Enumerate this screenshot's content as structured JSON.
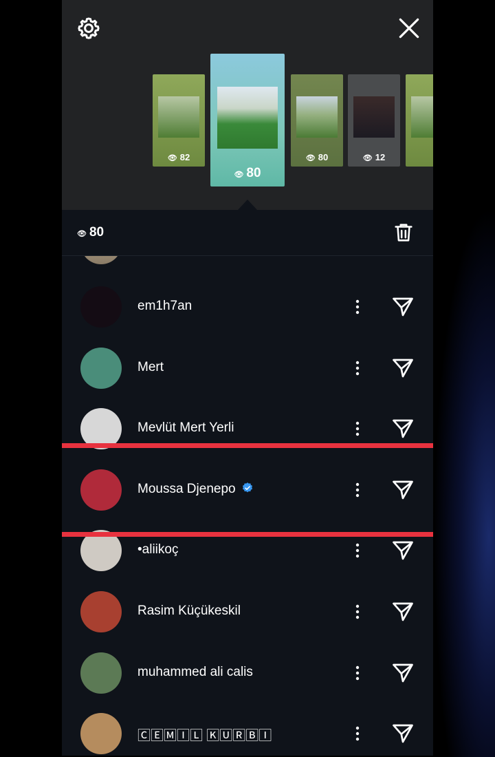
{
  "viewers_count": "80",
  "stories": [
    {
      "views": "82"
    },
    {
      "views": "80",
      "selected": true
    },
    {
      "views": "80"
    },
    {
      "views": "12"
    },
    {
      "views": ""
    }
  ],
  "viewers": [
    {
      "name": "em1h7an",
      "verified": false,
      "avatar_color": "#140c14"
    },
    {
      "name": "Mert",
      "verified": false,
      "avatar_color": "#4a8d7a"
    },
    {
      "name": "Mevlüt Mert Yerli",
      "verified": false,
      "avatar_color": "#d7d7d7"
    },
    {
      "name": "Moussa Djenepo",
      "verified": true,
      "avatar_color": "#b02a3a"
    },
    {
      "name": "•aliikoç",
      "verified": false,
      "avatar_color": "#cfcac3"
    },
    {
      "name": "Rasim Küçükeskil",
      "verified": false,
      "avatar_color": "#a84030"
    },
    {
      "name": "muhammed ali calis",
      "verified": false,
      "avatar_color": "#5c7a55"
    },
    {
      "name": "🄲🄴🄼🄸🄻 🄺🅄🅁🄱🄸",
      "verified": false,
      "avatar_color": "#b58c5e"
    }
  ],
  "colors": {
    "highlight": "#e8323f",
    "verified": "#3897f0",
    "panel": "#0f131a",
    "top": "#222325"
  },
  "icons": {
    "settings": "gear-icon",
    "close": "close-icon",
    "delete": "trash-icon",
    "more": "more-vertical-icon",
    "send": "send-icon",
    "views": "eye-icon"
  }
}
